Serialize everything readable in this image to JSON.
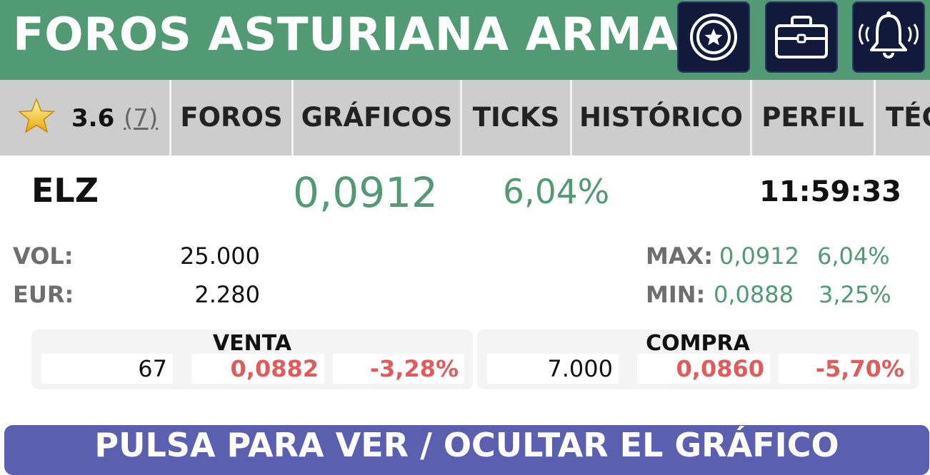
{
  "header": {
    "title": "FOROS ASTURIANA ARMA",
    "buttons": [
      {
        "icon": "star-badge-icon"
      },
      {
        "icon": "briefcase-icon"
      },
      {
        "icon": "bell-ringing-icon"
      }
    ]
  },
  "tabs": {
    "rating": {
      "icon": "star-icon",
      "value": "3.6",
      "count": "(7)"
    },
    "items": [
      "FOROS",
      "GRÁFICOS",
      "TICKS",
      "HISTÓRICO",
      "PERFIL",
      "TÉC"
    ]
  },
  "quote": {
    "ticker": "ELZ",
    "price": "0,0912",
    "change_pct": "6,04%",
    "time": "11:59:33"
  },
  "stats": {
    "vol_label": "VOL:",
    "vol": "25.000",
    "eur_label": "EUR:",
    "eur": "2.280",
    "max_label": "MAX:",
    "max_price": "0,0912",
    "max_pct": "6,04%",
    "min_label": "MIN:",
    "min_price": "0,0888",
    "min_pct": "3,25%"
  },
  "orderbook": {
    "sell": {
      "title": "VENTA",
      "qty": "67",
      "price": "0,0882",
      "pct": "-3,28%"
    },
    "buy": {
      "title": "COMPRA",
      "qty": "7.000",
      "price": "0,0860",
      "pct": "-5,70%"
    }
  },
  "chart_toggle": {
    "label": "PULSA PARA VER / OCULTAR EL GRÁFICO"
  },
  "colors": {
    "header_bg": "#519a74",
    "positive": "#519a74",
    "negative": "#e05b5b",
    "button_bg": "#5a5fb0",
    "icon_bg": "#121a3c"
  }
}
